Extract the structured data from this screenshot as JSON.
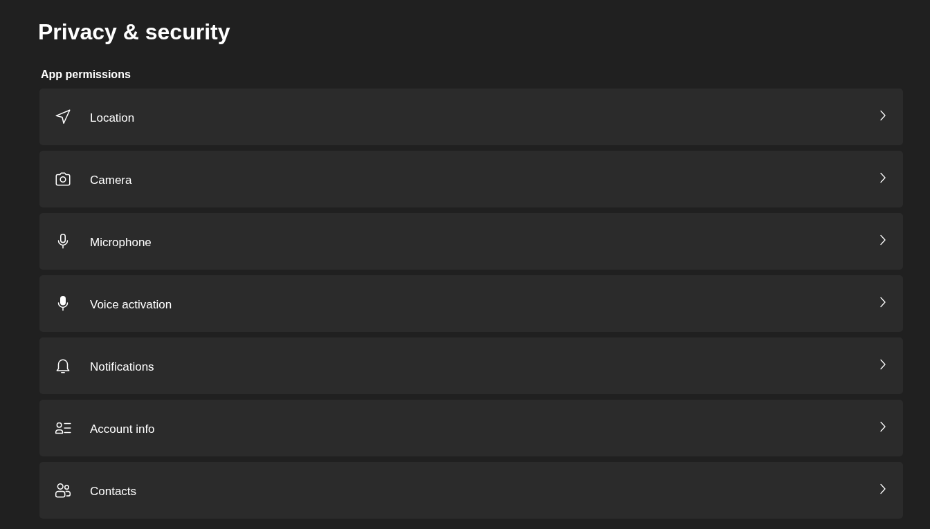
{
  "page_title": "Privacy & security",
  "section": {
    "heading": "App permissions",
    "items": [
      {
        "label": "Location"
      },
      {
        "label": "Camera"
      },
      {
        "label": "Microphone"
      },
      {
        "label": "Voice activation"
      },
      {
        "label": "Notifications"
      },
      {
        "label": "Account info"
      },
      {
        "label": "Contacts"
      }
    ]
  }
}
